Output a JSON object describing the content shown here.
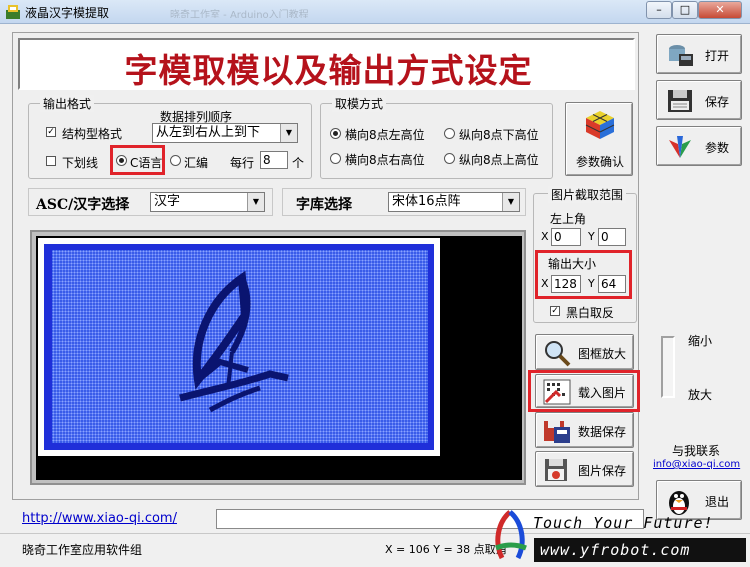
{
  "window": {
    "title": "液晶汉字模提取",
    "ghost_tabs": "晓奇工作室 - Arduino入门教程",
    "minimize": "–",
    "maximize": "□",
    "close": "✕"
  },
  "banner": "字模取模以及输出方式设定",
  "output_format": {
    "legend": "输出格式",
    "sort_label": "数据排列顺序",
    "struct_label": "结构型格式",
    "struct_checked": true,
    "sort_value": "从左到右从上到下",
    "underline_label": "下划线",
    "c_label": "C语言",
    "asm_label": "汇编",
    "per_row_label": "每行",
    "per_row_value": "8",
    "unit": "个"
  },
  "mode": {
    "legend": "取模方式",
    "options": [
      "横向8点左高位",
      "纵向8点下高位",
      "横向8点右高位",
      "纵向8点上高位"
    ]
  },
  "param_confirm": "参数确认",
  "asc_label": "ASC/汉字选择",
  "asc_value": "汉字",
  "font_label": "字库选择",
  "font_value": "宋体16点阵",
  "crop": {
    "legend": "图片截取范围",
    "top_left": "左上角",
    "x_label": "X",
    "y_label": "Y",
    "x_value": "0",
    "y_value": "0",
    "out_size": "输出大小",
    "w_value": "128",
    "h_value": "64",
    "bw_label": "黑白取反",
    "bw_checked": true
  },
  "buttons": {
    "zoom": "图框放大",
    "load": "载入图片",
    "save_data": "数据保存",
    "save_image": "图片保存",
    "open": "打开",
    "save": "保存",
    "params": "参数",
    "exit": "退出"
  },
  "slider": {
    "small": "缩小",
    "large": "放大"
  },
  "contact": {
    "label": "与我联系",
    "email": "info@xiao-qi.com"
  },
  "url": "http://www.xiao-qi.com/",
  "status": {
    "left": "晓奇工作室应用软件组",
    "coords": "X = 106 Y = 38 点取消"
  },
  "watermark": {
    "slogan": "Touch Your Future!",
    "site": "www.yfrobot.com"
  }
}
